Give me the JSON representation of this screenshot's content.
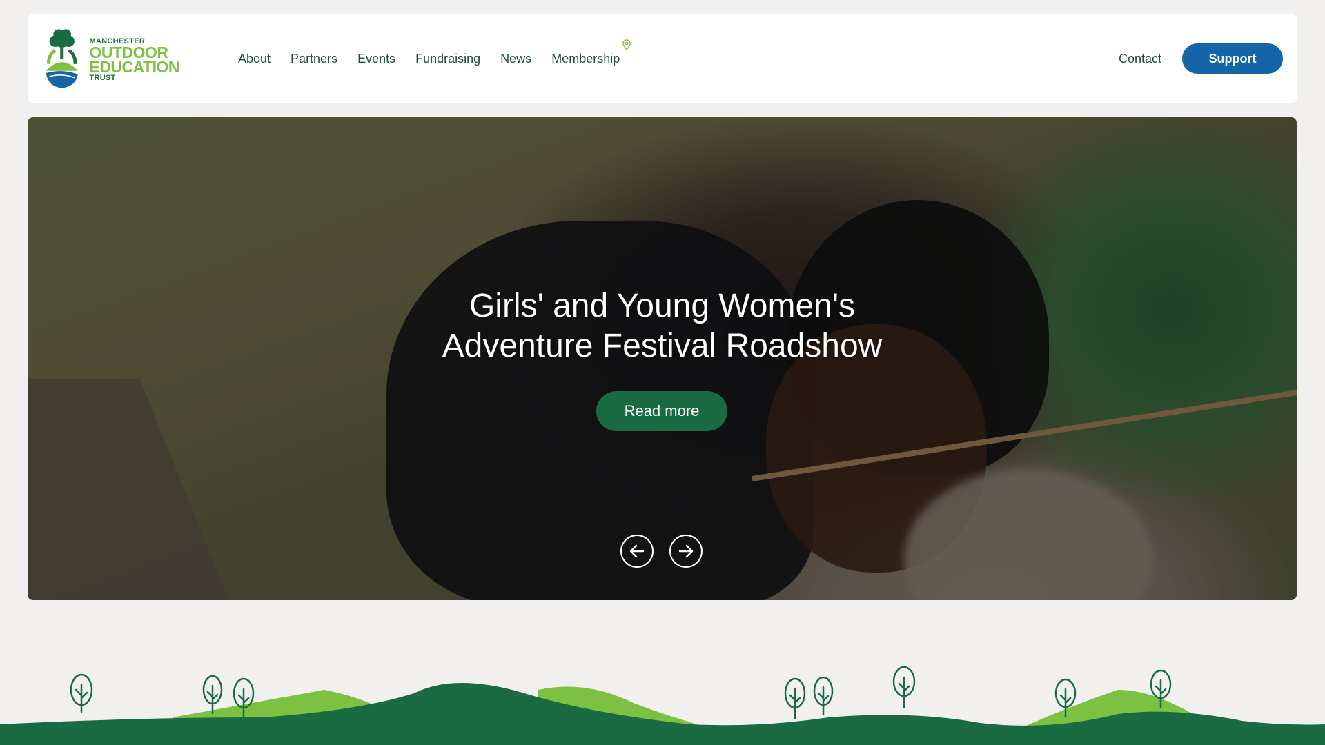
{
  "brand": {
    "line1": "MANCHESTER",
    "line2": "OUTDOOR",
    "line3": "EDUCATION",
    "line4": "TRUST",
    "colors": {
      "primary_green": "#1a6b42",
      "light_green": "#7cc142",
      "blue": "#1565a8"
    }
  },
  "nav": {
    "items": [
      {
        "label": "About"
      },
      {
        "label": "Partners"
      },
      {
        "label": "Events"
      },
      {
        "label": "Fundraising"
      },
      {
        "label": "News"
      },
      {
        "label": "Membership"
      }
    ],
    "contact_label": "Contact",
    "support_label": "Support"
  },
  "hero": {
    "title_line1": "Girls' and Young Women's",
    "title_line2": "Adventure Festival Roadshow",
    "cta_label": "Read more",
    "prev_icon": "arrow-left-icon",
    "next_icon": "arrow-right-icon"
  }
}
